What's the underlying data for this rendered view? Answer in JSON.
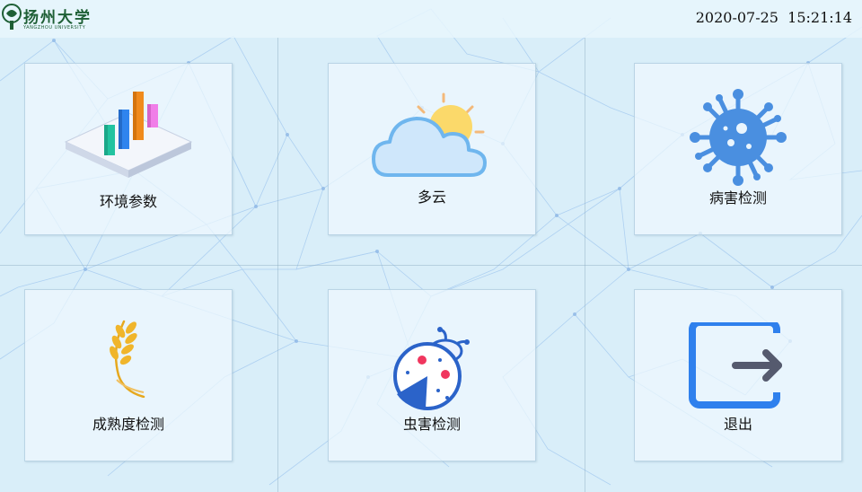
{
  "header": {
    "logo_name": "扬州大学",
    "logo_subtitle": "YANGZHOU UNIVERSITY",
    "datetime": "2020-07-25  15:21:14"
  },
  "menu": [
    {
      "label": "环境参数",
      "icon": "bar-chart-icon"
    },
    {
      "label": "多云",
      "icon": "partly-cloudy-icon"
    },
    {
      "label": "病害检测",
      "icon": "virus-icon"
    },
    {
      "label": "成熟度检测",
      "icon": "wheat-icon"
    },
    {
      "label": "虫害检测",
      "icon": "ladybug-icon"
    },
    {
      "label": "退出",
      "icon": "exit-icon"
    }
  ],
  "colors": {
    "background": "#d9eef9",
    "accent_blue": "#2f80ed",
    "virus_blue": "#4a8fe0",
    "wheat_gold": "#e6a81e"
  }
}
